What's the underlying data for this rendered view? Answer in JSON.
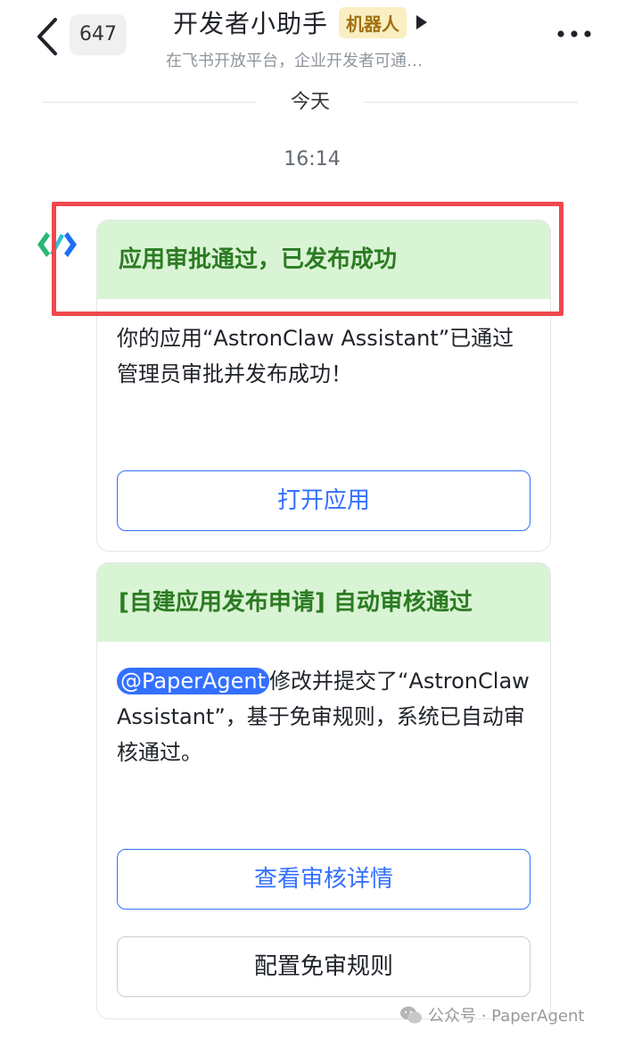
{
  "header": {
    "unread_count": "647",
    "title": "开发者小助手",
    "bot_tag": "机器人",
    "subtitle": "在飞书开放平台，企业开发者可通…"
  },
  "divider": {
    "date_label": "今天"
  },
  "timestamp": "16:14",
  "card1": {
    "title": "应用审批通过，已发布成功",
    "body": "你的应用“AstronClaw Assistant”已通过管理员审批并发布成功！",
    "button": "打开应用"
  },
  "card2": {
    "title": "[自建应用发布申请] 自动审核通过",
    "mention": "@PaperAgent",
    "body": "修改并提交了“AstronClaw Assistant”，基于免审规则，系统已自动审核通过。",
    "button_primary": "查看审核详情",
    "button_secondary": "配置免审规则"
  },
  "watermark": "公众号 · PaperAgent",
  "colors": {
    "accent": "#3370ff",
    "card_header_bg": "#d9f4d4",
    "card_header_text": "#2c7b23",
    "highlight": "#f0474d",
    "bot_tag_bg": "#faefc2"
  },
  "icons": {
    "back": "chevron-left-icon",
    "more": "more-dots-icon",
    "title_arrow": "caret-right-icon",
    "avatar": "bot-logo-icon",
    "watermark": "wechat-icon"
  }
}
